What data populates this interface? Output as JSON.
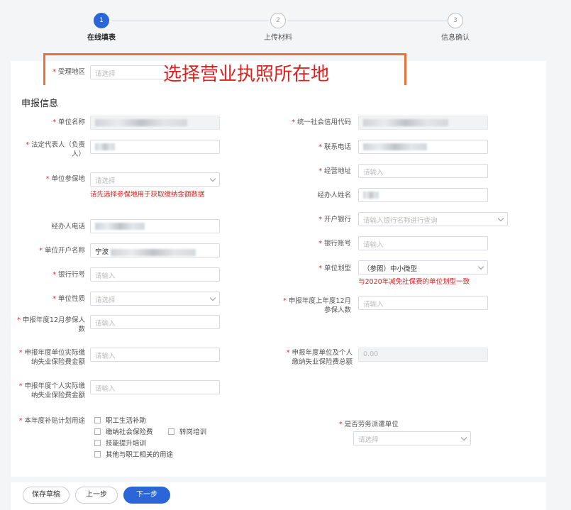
{
  "steps": [
    {
      "number": "1",
      "label": "在线填表"
    },
    {
      "number": "2",
      "label": "上传材料"
    },
    {
      "number": "3",
      "label": "信息确认"
    }
  ],
  "region": {
    "label": "受理地区",
    "placeholder": "请选择"
  },
  "annotation": "选择营业执照所在地",
  "section_title": "申报信息",
  "left": {
    "unit_name": {
      "label": "单位名称"
    },
    "legal_rep": {
      "label": "法定代表人（负责人）"
    },
    "insured_place": {
      "label": "单位参保地",
      "placeholder": "请选择",
      "warning": "请先选择参保地用于获取缴纳金额数据"
    },
    "handler_phone": {
      "label": "经办人电话"
    },
    "account_name": {
      "label": "单位开户名称",
      "value_prefix": "宁波"
    },
    "bank_code": {
      "label": "银行行号",
      "placeholder": "请输入"
    },
    "unit_nature": {
      "label": "单位性质",
      "placeholder": "请选择"
    },
    "dec_count": {
      "label": "申报年度12月参保人数",
      "placeholder": "请输入"
    },
    "unit_paid": {
      "label": "申报年度单位实际缴纳失业保险费金额",
      "placeholder": "请输入"
    },
    "person_paid": {
      "label": "申报年度个人实际缴纳失业保险费金额",
      "placeholder": "请输入"
    }
  },
  "right": {
    "credit_code": {
      "label": "统一社会信用代码"
    },
    "contact_phone": {
      "label": "联系电话"
    },
    "address": {
      "label": "经营地址",
      "placeholder": "请输入"
    },
    "handler_name": {
      "label": "经办人姓名"
    },
    "bank": {
      "label": "开户银行",
      "placeholder": "请输入银行名称进行查询"
    },
    "account_no": {
      "label": "银行账号",
      "placeholder": "请输入"
    },
    "unit_size": {
      "label": "单位划型",
      "value": "（参照）中小微型",
      "note": "与2020年减免社保费的单位划型一致"
    },
    "prev_count": {
      "label": "申报年度上年度12月参保人数",
      "placeholder": "请输入"
    },
    "total_paid": {
      "label": "申报年度单位及个人缴纳失业保险费总额",
      "value": "0.00"
    },
    "dispatch": {
      "label": "是否劳务派遣单位",
      "placeholder": "请选择"
    }
  },
  "subsidy": {
    "label": "本年度补贴计划用途",
    "options": [
      "职工生活补助",
      "缴纳社会保险费",
      "转岗培训",
      "技能提升培训",
      "其他与职工相关的用途"
    ]
  },
  "buttons": {
    "save": "保存草稿",
    "prev": "上一步",
    "next": "下一步"
  },
  "colors": {
    "primary": "#2a66d8",
    "required": "#e02b2b",
    "annotation": "#e8733a"
  }
}
